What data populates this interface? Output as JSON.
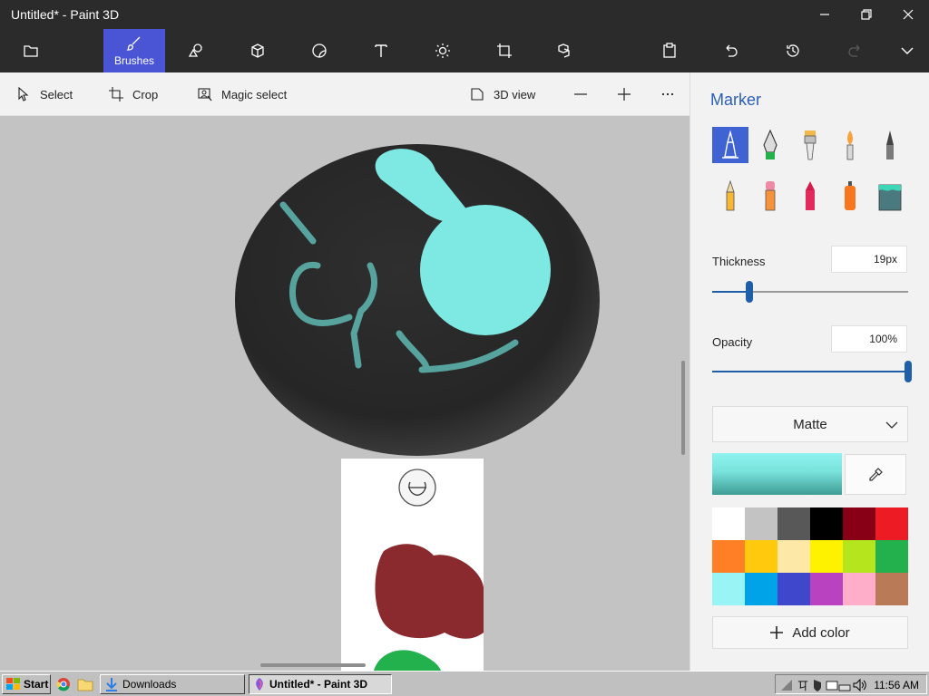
{
  "window": {
    "title": "Untitled* - Paint 3D"
  },
  "toolbar": {
    "active_label": "Brushes",
    "tools": [
      "open-menu",
      "brushes",
      "2d-shapes",
      "3d-shapes",
      "stickers",
      "text",
      "effects",
      "canvas",
      "3d-library",
      "paste",
      "undo",
      "history",
      "redo",
      "expand"
    ]
  },
  "subbar": {
    "select": "Select",
    "crop": "Crop",
    "magic_select": "Magic select",
    "view3d": "3D view"
  },
  "panel": {
    "title": "Marker",
    "thickness_label": "Thickness",
    "thickness_value": "19px",
    "thickness_level": 0.19,
    "opacity_label": "Opacity",
    "opacity_value": "100%",
    "opacity_level": 1.0,
    "finish": "Matte",
    "add_color": "Add color",
    "current_color": "#7ee8e2",
    "palette": [
      "#ffffff",
      "#c3c3c3",
      "#585858",
      "#000000",
      "#880015",
      "#ed1c24",
      "#ff7f27",
      "#ffc90e",
      "#fde8a8",
      "#fff200",
      "#b5e61d",
      "#22b14c",
      "#99f5f5",
      "#00a2e8",
      "#3f48cc",
      "#b842c0",
      "#ffaec9",
      "#b97a57"
    ],
    "brushes": [
      "marker-icon",
      "calligraphy-pen-icon",
      "oil-brush-icon",
      "watercolor-icon",
      "pixel-pen-icon",
      "pencil-icon",
      "eraser-icon",
      "crayon-icon",
      "spraycan-icon",
      "fill-icon"
    ]
  },
  "taskbar": {
    "start": "Start",
    "downloads": "Downloads",
    "active_app": "Untitled* - Paint 3D",
    "clock": "11:56 AM"
  }
}
